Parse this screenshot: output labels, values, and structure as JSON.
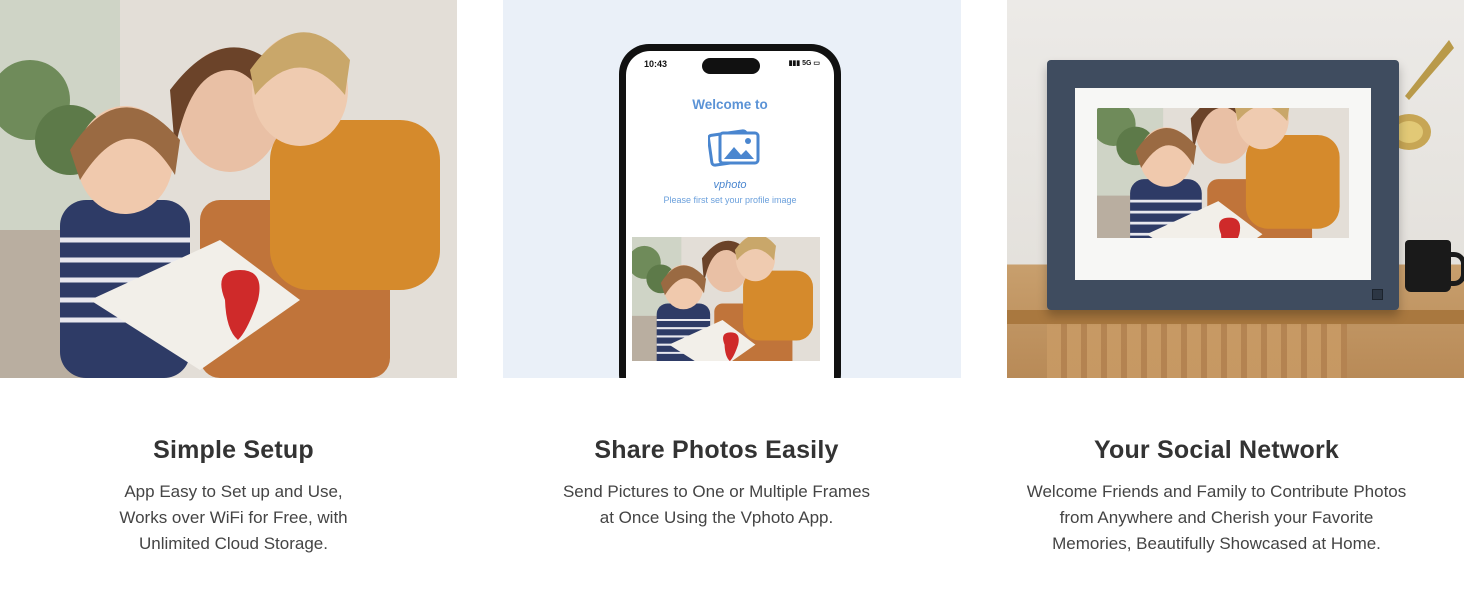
{
  "features": [
    {
      "title": "Simple Setup",
      "lines": [
        "App Easy to Set up and Use,",
        "Works over WiFi for Free, with",
        "Unlimited Cloud Storage."
      ]
    },
    {
      "title": "Share Photos Easily",
      "lines": [
        "Send Pictures to One or Multiple Frames",
        "at Once Using the Vphoto App."
      ]
    },
    {
      "title": "Your Social Network",
      "lines": [
        "Welcome Friends and Family to Contribute Photos",
        "from Anywhere and Cherish your Favorite",
        "Memories, Beautifully Showcased at Home."
      ]
    }
  ],
  "phone": {
    "time": "10:43",
    "status": "5G",
    "welcome": "Welcome to",
    "brand": "vphoto",
    "hint": "Please first set your profile image"
  },
  "colors": {
    "app_blue": "#5b93d6",
    "frame_navy": "#3f4c5f",
    "heading": "#333333",
    "body_text": "#444444"
  }
}
